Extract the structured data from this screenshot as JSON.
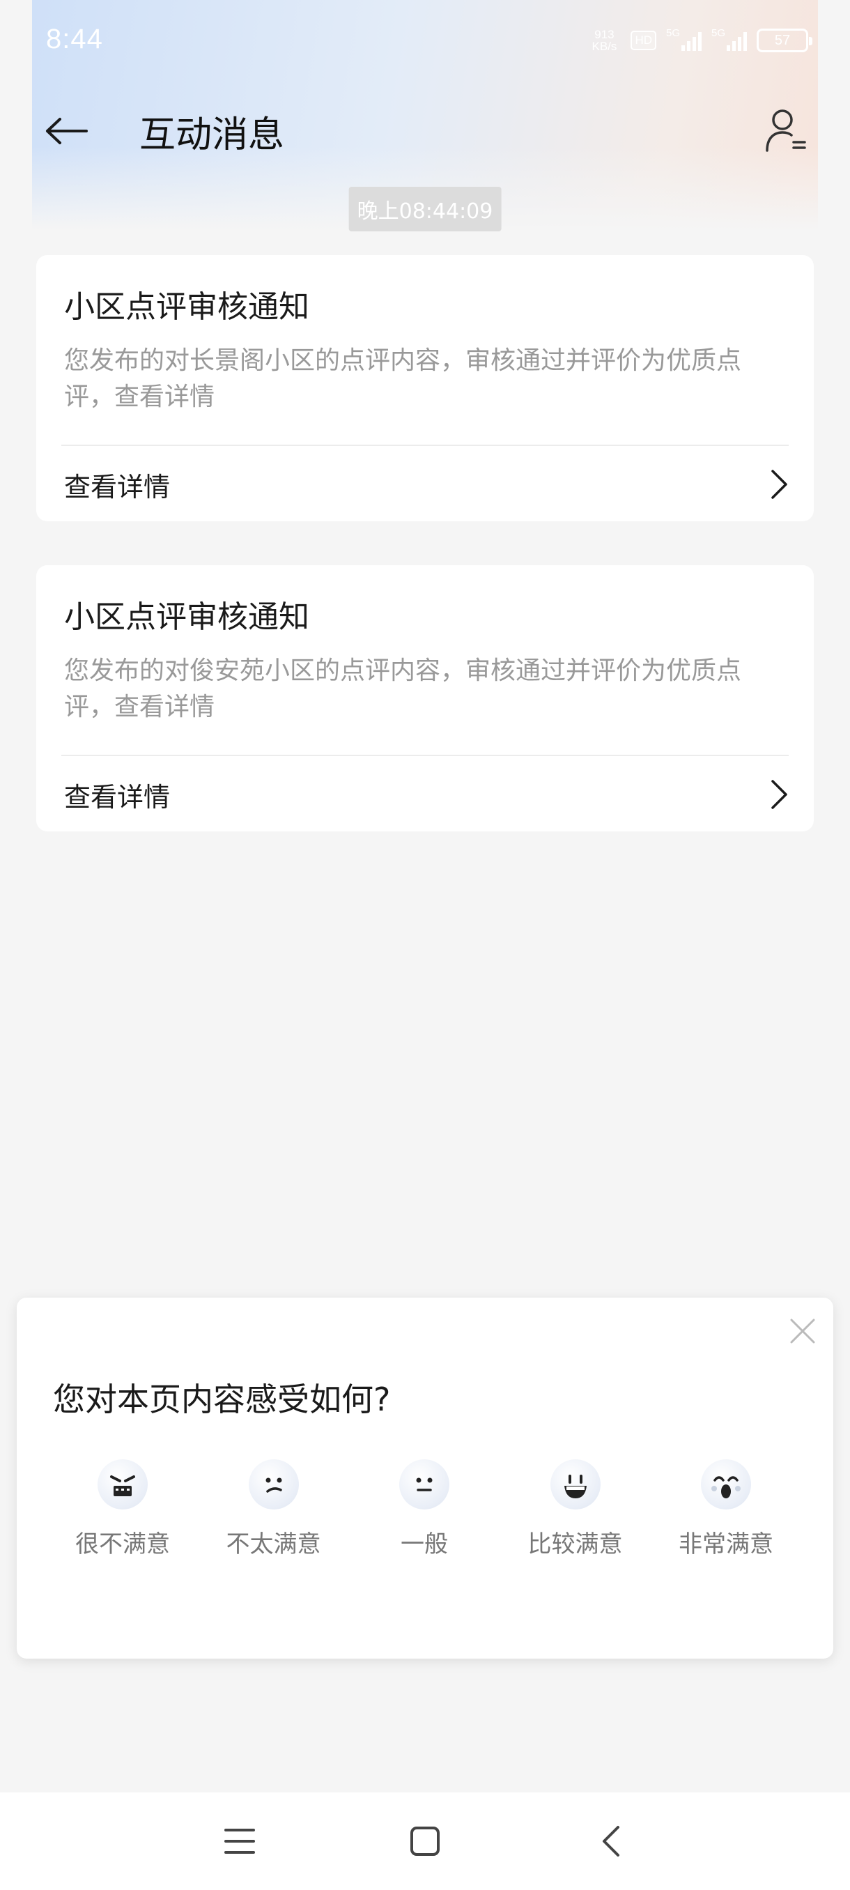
{
  "status_bar": {
    "time": "8:44",
    "net_speed_value": "913",
    "net_speed_unit": "KB/s",
    "hd_label": "HD",
    "sim1_label": "5G",
    "sim2_label": "5G",
    "battery_level": "57"
  },
  "header": {
    "title": "互动消息",
    "back_icon": "arrow-left-icon",
    "profile_icon": "user-settings-icon"
  },
  "timestamp": "晚上08:44:09",
  "messages": [
    {
      "title": "小区点评审核通知",
      "body": "您发布的对长景阁小区的点评内容，审核通过并评价为优质点评，查看详情",
      "link_label": "查看详情"
    },
    {
      "title": "小区点评审核通知",
      "body": "您发布的对俊安苑小区的点评内容，审核通过并评价为优质点评，查看详情",
      "link_label": "查看详情"
    }
  ],
  "feedback": {
    "question": "您对本页内容感受如何?",
    "options": [
      {
        "label": "很不满意",
        "icon": "angry-face-icon"
      },
      {
        "label": "不太满意",
        "icon": "unhappy-face-icon"
      },
      {
        "label": "一般",
        "icon": "neutral-face-icon"
      },
      {
        "label": "比较满意",
        "icon": "smile-face-icon"
      },
      {
        "label": "非常满意",
        "icon": "surprised-happy-face-icon"
      }
    ]
  },
  "system_nav": {
    "menu_icon": "menu-icon",
    "home_icon": "home-square-icon",
    "back_icon": "back-chevron-icon"
  }
}
